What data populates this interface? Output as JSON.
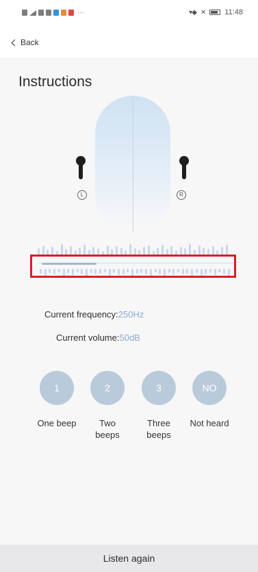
{
  "status_bar": {
    "time": "11:48",
    "left_icons": [
      "sim-icon",
      "signal-icon",
      "wifi-icon",
      "notification-icon",
      "app-icon-blue",
      "app-icon-orange",
      "app-icon-red"
    ],
    "more_dots": "···"
  },
  "nav": {
    "back_label": "Back"
  },
  "page": {
    "title": "Instructions"
  },
  "ears": {
    "left_label": "L",
    "right_label": "R"
  },
  "info": {
    "frequency_label": "Current frequency:",
    "frequency_value": "250Hz",
    "volume_label": "Current volume:",
    "volume_value": "50dB"
  },
  "options": [
    {
      "number": "1",
      "label": "One beep"
    },
    {
      "number": "2",
      "label": "Two beeps"
    },
    {
      "number": "3",
      "label": "Three beeps"
    },
    {
      "number": "NO",
      "label": "Not heard"
    }
  ],
  "footer": {
    "listen_again": "Listen again"
  },
  "colors": {
    "accent_value": "#8fa9d6",
    "highlight_border": "#d81f26",
    "circle_fill": "#b9cadb"
  }
}
